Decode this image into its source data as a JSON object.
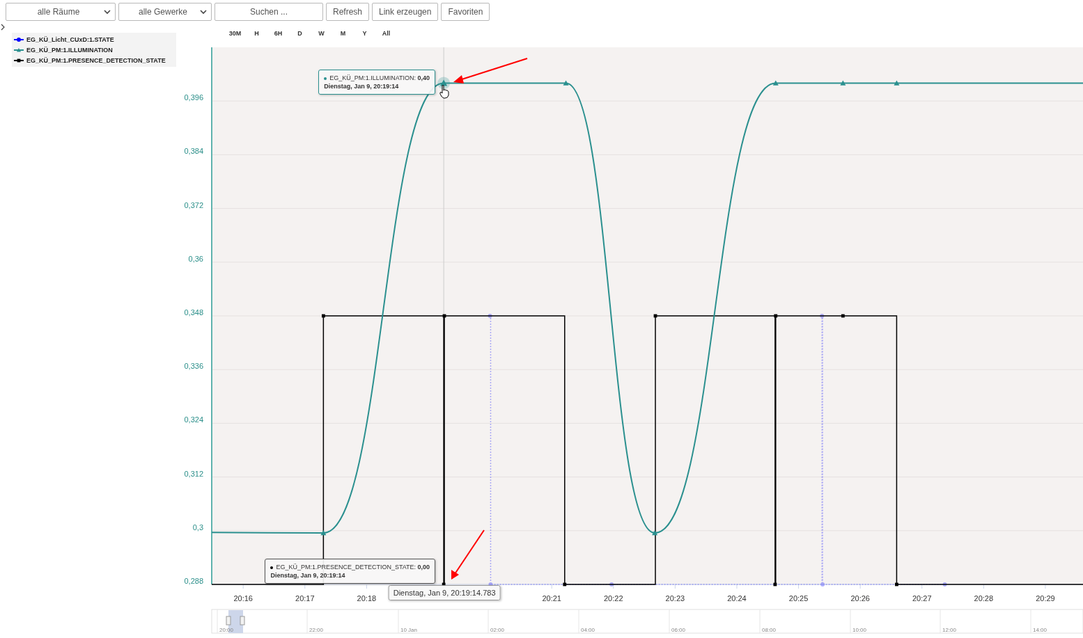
{
  "toolbar": {
    "room_select": "alle Räume",
    "trade_select": "alle Gewerke",
    "search": {
      "placeholder": "Suchen ..."
    },
    "buttons": [
      "Refresh",
      "Link erzeugen",
      "Favoriten"
    ]
  },
  "range_buttons": [
    {
      "label": "30M",
      "selected": false
    },
    {
      "label": "H",
      "selected": false
    },
    {
      "label": "6H",
      "selected": false
    },
    {
      "label": "D",
      "selected": false
    },
    {
      "label": "W",
      "selected": false
    },
    {
      "label": "M",
      "selected": false
    },
    {
      "label": "Y",
      "selected": false
    },
    {
      "label": "All",
      "selected": false
    }
  ],
  "legend": {
    "expanded": false
  },
  "chart_data": {
    "type": "line",
    "grid": true,
    "ref_lines": [
      {
        "axis": "x",
        "value": 1219.25
      }
    ],
    "x": [
      1215.49,
      1217.3,
      1219.25,
      1219.26,
      1220.0,
      1220.01,
      1221.21,
      1221.23,
      1221.97,
      1222.67,
      1222.68,
      1224.62,
      1224.63,
      1225.38,
      1225.39,
      1225.72,
      1226.59,
      1227.37,
      1229.61
    ],
    "xlim": [
      1215.49,
      1229.61
    ],
    "ylim": [
      0.288,
      0.408
    ],
    "xticks": [
      {
        "value": 1216,
        "label": "20:16"
      },
      {
        "value": 1217,
        "label": "20:17"
      },
      {
        "value": 1218,
        "label": "20:18"
      },
      {
        "value": 1221,
        "label": "20:21"
      },
      {
        "value": 1222,
        "label": "20:22"
      },
      {
        "value": 1223,
        "label": "20:23"
      },
      {
        "value": 1224,
        "label": "20:24"
      },
      {
        "value": 1225,
        "label": "20:25"
      },
      {
        "value": 1226,
        "label": "20:26"
      },
      {
        "value": 1227,
        "label": "20:27"
      },
      {
        "value": 1228,
        "label": "20:28"
      },
      {
        "value": 1229,
        "label": "20:29"
      }
    ],
    "yticks": [
      {
        "value": 0.288,
        "label": "0,288"
      },
      {
        "value": 0.3,
        "label": "0,3"
      },
      {
        "value": 0.312,
        "label": "0,312"
      },
      {
        "value": 0.324,
        "label": "0,324"
      },
      {
        "value": 0.336,
        "label": "0,336"
      },
      {
        "value": 0.348,
        "label": "0,348"
      },
      {
        "value": 0.36,
        "label": "0,36"
      },
      {
        "value": 0.372,
        "label": "0,372"
      },
      {
        "value": 0.384,
        "label": "0,384"
      },
      {
        "value": 0.396,
        "label": "0,396"
      }
    ],
    "series": [
      {
        "name": "EG_KÜ_Licht_CUxD:1.STATE",
        "color": "#0000ff",
        "type": "step",
        "marker": "circle",
        "line_style": "dashed",
        "values": [
          null,
          null,
          null,
          null,
          0.348,
          0.288,
          null,
          null,
          0.288,
          null,
          null,
          null,
          null,
          0.348,
          0.288,
          null,
          null,
          0.288,
          null
        ]
      },
      {
        "name": "EG_KÜ_PM:1.ILLUMINATION",
        "color": "#2b908f",
        "type": "line",
        "marker": "triangle",
        "values": [
          0.2996,
          0.2995,
          0.4,
          null,
          null,
          null,
          null,
          0.4,
          null,
          0.2995,
          null,
          null,
          0.4,
          null,
          null,
          0.4,
          0.4,
          null,
          0.4
        ]
      },
      {
        "name": "EG_KÜ_PM:1.PRESENCE_DETECTION_STATE",
        "color": "#000000",
        "type": "step",
        "marker": "square",
        "values": [
          0.288,
          0.348,
          0.288,
          0.348,
          null,
          null,
          0.288,
          null,
          null,
          null,
          0.348,
          0.288,
          0.348,
          null,
          null,
          0.348,
          0.288,
          null,
          0.288
        ]
      }
    ]
  },
  "tooltips": [
    {
      "text": "EG_KÜ_PM:1.ILLUMINATION: **0,40**",
      "date": "Dienstag, Jan 9, 20:19:14"
    },
    {
      "text": "EG_KÜ_PM:1.PRESENCE_DETECTION_STATE: **0,00**",
      "date": "Dienstag, Jan 9, 20:19:14"
    }
  ],
  "crosshair_label": "Dienstag, Jan 9, 20:19:14.783",
  "navigator": {
    "labels": [
      "20:00",
      "22:00",
      "10 Jan",
      "02:00",
      "04:00",
      "06:00",
      "08:00",
      "10:00",
      "12:00",
      "14:00"
    ]
  }
}
